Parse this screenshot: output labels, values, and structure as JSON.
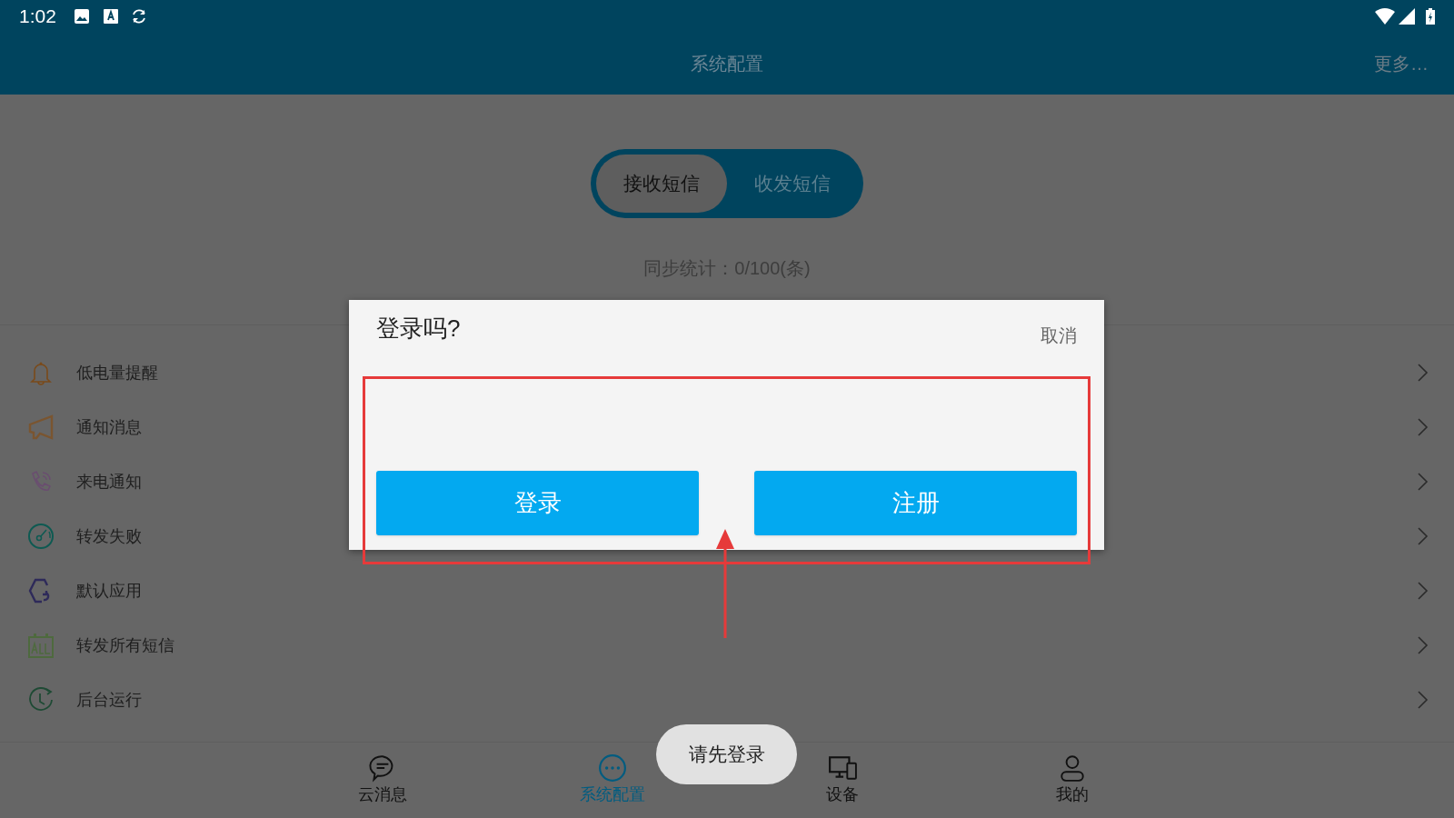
{
  "status_bar": {
    "time": "1:02"
  },
  "header": {
    "title": "系统配置",
    "more": "更多…"
  },
  "tabs": [
    {
      "label": "接收短信",
      "selected": true
    },
    {
      "label": "收发短信",
      "selected": false
    }
  ],
  "sync_stats": "同步统计：0/100(条)",
  "settings": [
    {
      "kind": "bell",
      "label": "低电量提醒",
      "color": "#7a4a1a"
    },
    {
      "kind": "megaphone",
      "label": "通知消息",
      "color": "#7a5530"
    },
    {
      "kind": "phone",
      "label": "来电通知",
      "color": "#6a4d70"
    },
    {
      "kind": "gauge",
      "label": "转发失败",
      "color": "#0e5a52"
    },
    {
      "kind": "hexagon",
      "label": "默认应用",
      "color": "#2e2a5a"
    },
    {
      "kind": "all",
      "label": "转发所有短信",
      "color": "#4e6a3e"
    },
    {
      "kind": "clock",
      "label": "后台运行",
      "color": "#1e4a34"
    }
  ],
  "dialog": {
    "title": "登录吗?",
    "cancel": "取消",
    "buttons": [
      "登录",
      "注册"
    ]
  },
  "toast": "请先登录",
  "nav": [
    {
      "kind": "chat",
      "label": "云消息",
      "selected": false
    },
    {
      "kind": "dots",
      "label": "系统配置",
      "selected": true
    },
    {
      "kind": "devices",
      "label": "设备",
      "selected": false
    },
    {
      "kind": "person",
      "label": "我的",
      "selected": false
    }
  ]
}
